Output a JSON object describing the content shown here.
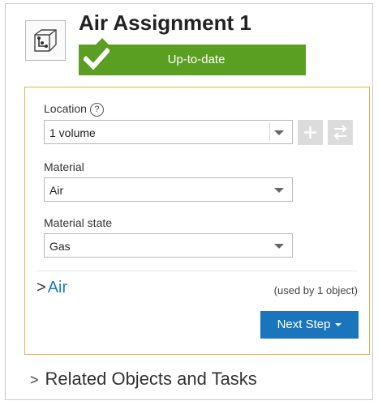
{
  "header": {
    "title": "Air Assignment 1",
    "icon": "volume-assignment-icon",
    "status": {
      "label": "Up-to-date",
      "icon": "checkmark-icon",
      "color": "#5a9e22"
    }
  },
  "form": {
    "location": {
      "label": "Location",
      "help_icon": "?",
      "value": "1 volume",
      "add_icon": "+",
      "swap_icon": "⇄"
    },
    "material": {
      "label": "Material",
      "value": "Air"
    },
    "material_state": {
      "label": "Material state",
      "value": "Gas"
    },
    "material_link": {
      "chevron": ">",
      "label": "Air",
      "usage": "(used by 1 object)"
    },
    "next_step": {
      "label": "Next Step"
    }
  },
  "related": {
    "chevron": ">",
    "label": "Related Objects and Tasks"
  },
  "colors": {
    "accent": "#1b75bc",
    "link": "#1a7cc4",
    "status_green": "#5a9e22",
    "form_border": "#e2b04a"
  }
}
